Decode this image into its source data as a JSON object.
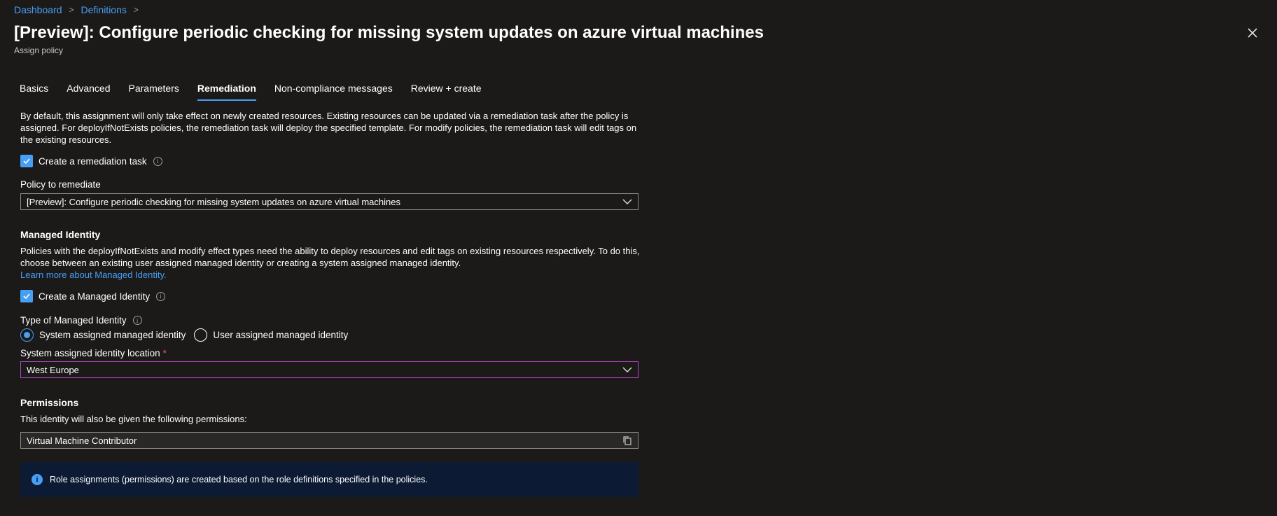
{
  "breadcrumb": {
    "items": [
      "Dashboard",
      "Definitions"
    ]
  },
  "header": {
    "title": "[Preview]: Configure periodic checking for missing system updates on azure virtual machines",
    "subtitle": "Assign policy",
    "more": "···"
  },
  "tabs": [
    {
      "label": "Basics"
    },
    {
      "label": "Advanced"
    },
    {
      "label": "Parameters"
    },
    {
      "label": "Remediation",
      "active": true
    },
    {
      "label": "Non-compliance messages"
    },
    {
      "label": "Review + create"
    }
  ],
  "remediation": {
    "intro": "By default, this assignment will only take effect on newly created resources. Existing resources can be updated via a remediation task after the policy is assigned. For deployIfNotExists policies, the remediation task will deploy the specified template. For modify policies, the remediation task will edit tags on the existing resources.",
    "create_task_label": "Create a remediation task",
    "create_task_checked": true,
    "policy_label": "Policy to remediate",
    "policy_value": "[Preview]: Configure periodic checking for missing system updates on azure virtual machines"
  },
  "managed_identity": {
    "heading": "Managed Identity",
    "description": "Policies with the deployIfNotExists and modify effect types need the ability to deploy resources and edit tags on existing resources respectively. To do this, choose between an existing user assigned managed identity or creating a system assigned managed identity.",
    "learn_more": "Learn more about Managed Identity.",
    "create_label": "Create a Managed Identity",
    "create_checked": true,
    "type_label": "Type of Managed Identity",
    "option_system": "System assigned managed identity",
    "option_user": "User assigned managed identity",
    "selected": "system",
    "location_label": "System assigned identity location",
    "location_required": "*",
    "location_value": "West Europe"
  },
  "permissions": {
    "heading": "Permissions",
    "description": "This identity will also be given the following permissions:",
    "role": "Virtual Machine Contributor",
    "banner": "Role assignments (permissions) are created based on the role definitions specified in the policies."
  },
  "icons": {
    "info": "info-icon",
    "chevron": "chevron-down-icon",
    "close": "close-icon",
    "copy": "copy-icon",
    "check": "checkmark-icon"
  },
  "colors": {
    "background": "#1b1a19",
    "accent": "#479ef5",
    "focus_border": "#b146c2",
    "banner_bg": "#0c1a33"
  }
}
